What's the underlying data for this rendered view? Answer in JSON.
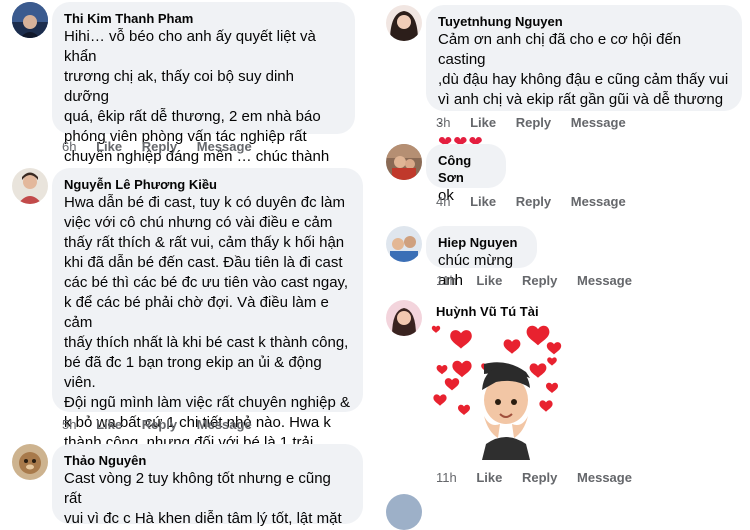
{
  "actions": {
    "like": "Like",
    "reply": "Reply",
    "message": "Message"
  },
  "left_comments": [
    {
      "author": "Thi Kim Thanh Pham",
      "text": "Hihi… vỗ béo cho anh ấy quyết liệt và khẩn\ntrương chị ak, thấy coi bộ suy dinh dưỡng\nquá, êkip rất dễ thương, 2 em nhà báo\nphóng viên phòng vấn tác nghiệp rất\nchuyên nghiệp đáng mến … chúc thành\ncông",
      "time": "6h"
    },
    {
      "author": "Nguyễn Lê Phương Kiều",
      "text": "Hwa dẫn bé đi cast, tuy k có duyên đc làm\nviệc với cô chú nhưng có vài điều e cảm\nthấy rất thích & rất vui, cảm thấy k hối hận\nkhi đã dẫn bé đến cast. Đầu tiên là đi cast\ncác bé thì các bé đc ưu tiên vào cast ngay,\nk để các bé phải chờ đợi. Và điều làm e cảm\nthấy thích nhất là khi bé cast k thành công,\nbé đã đc 1 bạn trong ekip an ủi & động viên.\nĐội ngũ mình làm việc rất chuyên nghiệp &\nk bỏ wa bất cứ 1 chi tiết nhỏ nào. Hwa k\nthành công, nhưng đối với bé là 1 trải\nnghiệm rất thú vị. E xin cảm ơn mn",
      "emoji": "❤",
      "time": "5h"
    },
    {
      "author": "Thảo Nguyên",
      "text": "Cast vòng 2 tuy không tốt nhưng e cũng rất\nvui vì đc c Hà khen diễn tâm lý tốt, lật mặt"
    }
  ],
  "right_comments": [
    {
      "author": "Tuyetnhung Nguyen",
      "text": "Cảm ơn anh chị đã cho e cơ hội đến casting\n,dù đậu hay không đậu e cũng cảm thấy vui\nvì anh chị và ekip rất gần gũi và dễ thương .",
      "hearts": "❤❤❤",
      "time": "3h"
    },
    {
      "author": "Công Sơn",
      "text": "ok",
      "time": "4h"
    },
    {
      "author": "Hiep Nguyen",
      "text": "chúc mừng anh",
      "time": "11h"
    },
    {
      "author": "Huỳnh Vũ Tú Tài",
      "time": "11h"
    }
  ]
}
